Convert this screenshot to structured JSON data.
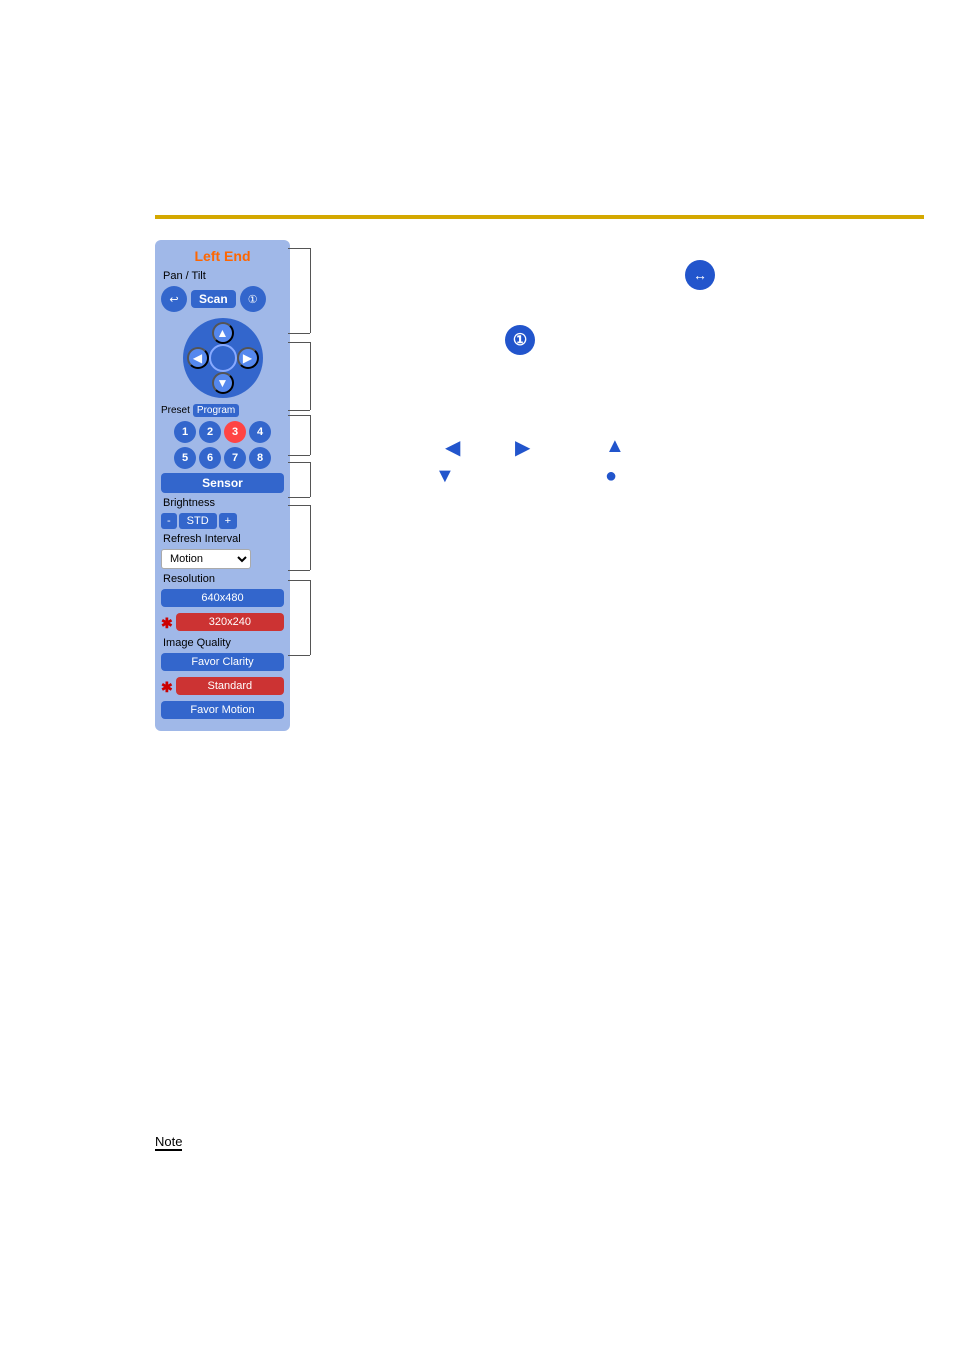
{
  "panel": {
    "title": "Left End",
    "sections": {
      "pan_tilt_label": "Pan / Tilt",
      "scan_label": "Scan",
      "preset_label": "Preset",
      "program_label": "Program",
      "sensor_label": "Sensor",
      "brightness_label": "Brightness",
      "brightness_std": "STD",
      "brightness_minus": "-",
      "brightness_plus": "+",
      "refresh_label": "Refresh Interval",
      "refresh_value": "Motion",
      "resolution_label": "Resolution",
      "resolution_high": "640x480",
      "resolution_low": "320x240",
      "image_quality_label": "Image Quality",
      "iq_favor_clarity": "Favor Clarity",
      "iq_standard": "Standard",
      "iq_favor_motion": "Favor Motion"
    },
    "num_buttons": [
      "1",
      "2",
      "3",
      "4",
      "5",
      "6",
      "7",
      "8"
    ],
    "active_num": "3",
    "active_res": "320x240",
    "active_iq": "Standard"
  },
  "annotations": {
    "circle1_label": "1",
    "circle2_label": "↔",
    "arrow_left": "◀",
    "arrow_right": "▶",
    "arrow_up": "▲",
    "arrow_down_left": "▼",
    "arrow_down_right": "●"
  },
  "footer": {
    "note_label": "Note"
  }
}
